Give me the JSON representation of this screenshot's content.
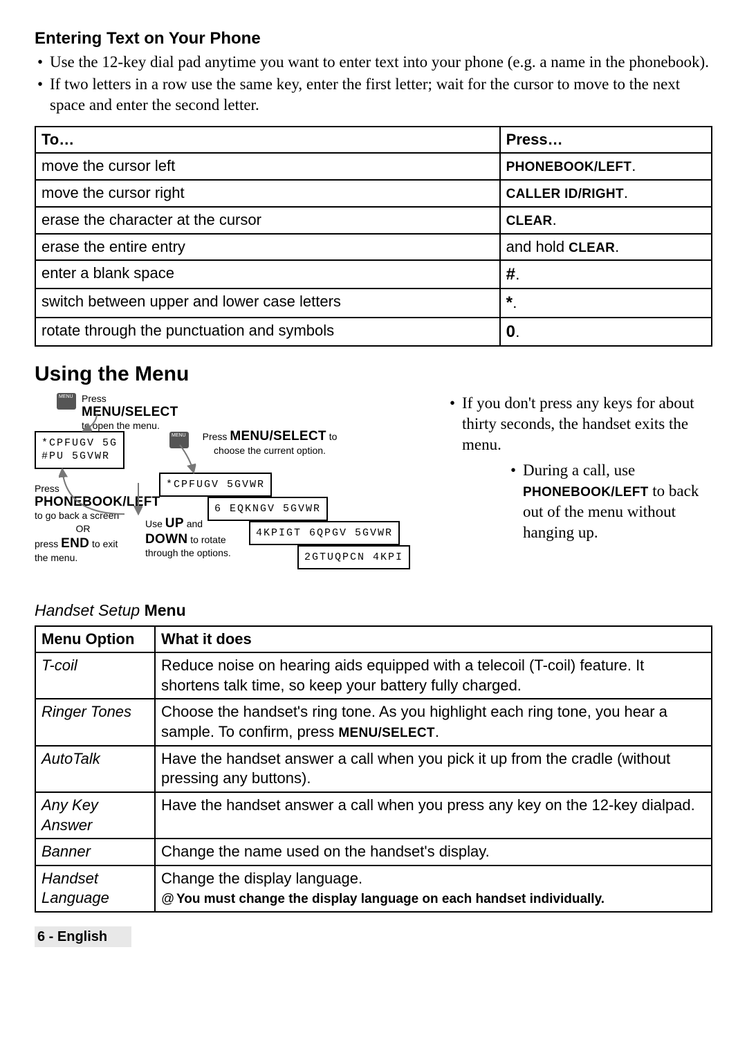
{
  "section1": {
    "title": "Entering Text on Your Phone",
    "bullets": [
      "Use the 12-key dial pad anytime you want to enter text into your phone (e.g. a name in the phonebook).",
      "If two letters in a row use the same key, enter the first letter; wait for the cursor to move to the next space and enter the second letter."
    ],
    "table_headers": {
      "to": "To…",
      "press": "Press…"
    },
    "rows": [
      {
        "to": "move the cursor left",
        "press_text": "",
        "press_key": "PHONEBOOK/LEFT",
        "suffix": "."
      },
      {
        "to": "move the cursor right",
        "press_text": "",
        "press_key": "CALLER ID/RIGHT",
        "suffix": "."
      },
      {
        "to": "erase the character at the cursor",
        "press_text": "",
        "press_key": "CLEAR",
        "suffix": "."
      },
      {
        "to": "erase the entire entry",
        "press_text": "and hold ",
        "press_key": "CLEAR",
        "suffix": "."
      },
      {
        "to": "enter a blank space",
        "press_text": "",
        "press_key": "#",
        "suffix": "."
      },
      {
        "to": "switch between upper and lower case letters",
        "press_text": "",
        "press_key": "*",
        "suffix": "."
      },
      {
        "to": "rotate through the punctuation and symbols",
        "press_text": "",
        "press_key": "0",
        "suffix": "."
      }
    ]
  },
  "section2": {
    "title": "Using the Menu",
    "diagram": {
      "label_open1": "Press",
      "label_open_key": "MENU/SELECT",
      "label_open2": "to open the menu.",
      "label_choose1": "Press",
      "label_choose_key": "MENU/SELECT",
      "label_choose2": "to choose the current option.",
      "label_rotate1": "Use",
      "label_rotate_key1": "UP",
      "label_rotate2": "and",
      "label_rotate_key2": "DOWN",
      "label_rotate3": "to rotate through the options.",
      "label_back1": "Press",
      "label_back_key": "PHONEBOOK/LEFT",
      "label_back2": "to go back a screen",
      "label_back3": "OR",
      "label_back4": "press",
      "label_back_key2": "END",
      "label_back5": "to exit the menu.",
      "box1_line1": "*CPFUGV 5G",
      "box1_line2": "#PU   5GVWR",
      "box2": "*CPFUGV 5GVWR",
      "box3": "6 EQKNGV 5GVWR",
      "box4": "4KPIGT 6QPGV 5GVWR",
      "box5": "2GTUQPCN 4KPI"
    },
    "side_notes": [
      "If you don't press any keys for about thirty seconds, the handset exits the menu.",
      {
        "text_pre": "During a call, use ",
        "key": "PHONEBOOK/LEFT",
        "text_post": " to back out of the menu without hanging up."
      }
    ],
    "subheader_ital": "Handset Setup",
    "subheader_bold": "Menu",
    "menu_headers": {
      "option": "Menu Option",
      "what": "What it does"
    },
    "menu_rows": [
      {
        "option": "T-coil",
        "what": "Reduce noise on hearing aids equipped with a telecoil (T-coil) feature. It shortens talk time, so keep your battery fully charged."
      },
      {
        "option": "Ringer Tones",
        "what_pre": "Choose the handset's ring tone. As you highlight each ring tone, you hear a sample. To confirm, press ",
        "what_key": "MENU/SELECT",
        "what_post": "."
      },
      {
        "option": "AutoTalk",
        "what": "Have the handset answer a call when you pick it up from the cradle (without pressing any buttons)."
      },
      {
        "option": "Any Key Answer",
        "what": "Have the handset answer a call when you press any key on the 12-key dialpad."
      },
      {
        "option": "Banner",
        "what": "Change the name used on the handset's display."
      },
      {
        "option": "Handset Language",
        "what": "Change the display language.",
        "note_symbol": "@",
        "note": "You must change the display language on each handset individually."
      }
    ]
  },
  "footer": "6 - English"
}
